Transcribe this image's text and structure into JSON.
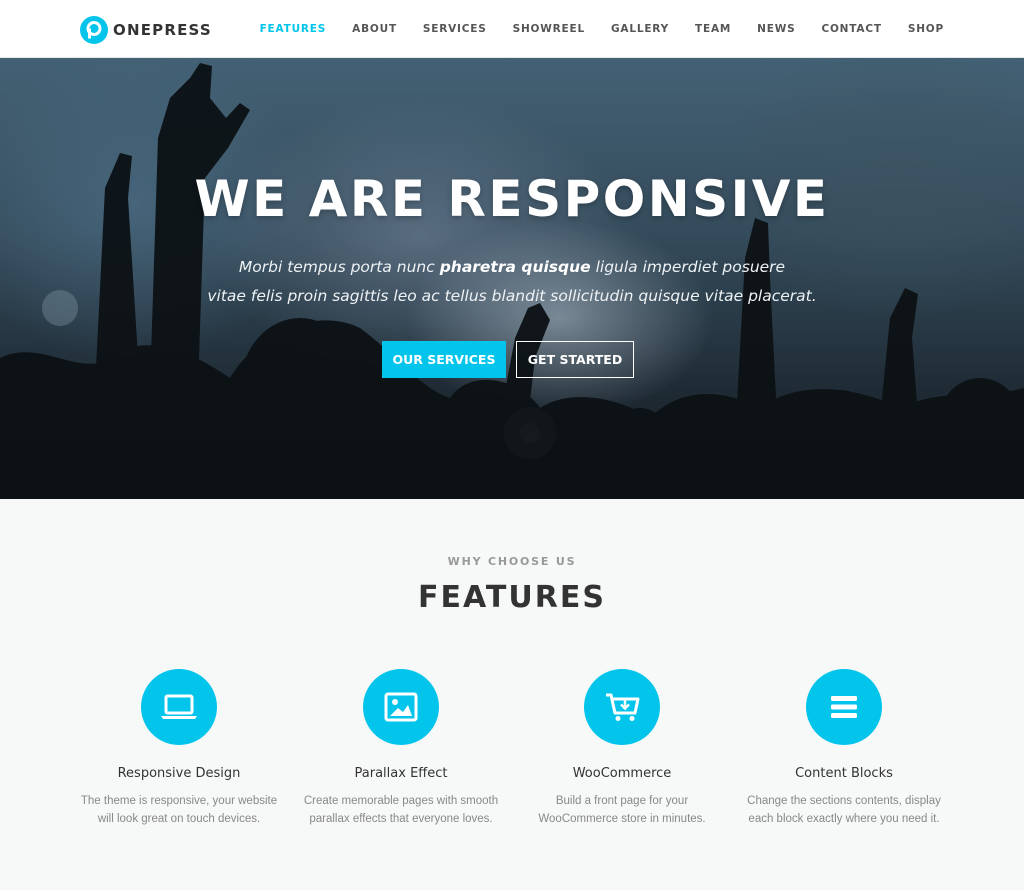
{
  "brand": {
    "name": "ONEPRESS",
    "accent_color": "#03c4eb"
  },
  "nav": {
    "items": [
      {
        "label": "FEATURES",
        "active": true
      },
      {
        "label": "ABOUT",
        "active": false
      },
      {
        "label": "SERVICES",
        "active": false
      },
      {
        "label": "SHOWREEL",
        "active": false
      },
      {
        "label": "GALLERY",
        "active": false
      },
      {
        "label": "TEAM",
        "active": false
      },
      {
        "label": "NEWS",
        "active": false
      },
      {
        "label": "CONTACT",
        "active": false
      },
      {
        "label": "SHOP",
        "active": false
      }
    ]
  },
  "hero": {
    "title": "WE ARE RESPONSIVE",
    "subtitle_part1": "Morbi tempus porta nunc ",
    "subtitle_bold": "pharetra quisque",
    "subtitle_part2": " ligula imperdiet posuere",
    "subtitle_line2": "vitae felis proin sagittis leo ac tellus blandit sollicitudin quisque vitae placerat.",
    "primary_button": "OUR SERVICES",
    "secondary_button": "GET STARTED"
  },
  "features": {
    "subtitle": "WHY CHOOSE US",
    "title": "FEATURES",
    "items": [
      {
        "icon": "laptop-icon",
        "title": "Responsive Design",
        "desc_line1": "The theme is responsive, your website",
        "desc_line2": "will look great on touch devices."
      },
      {
        "icon": "image-icon",
        "title": "Parallax Effect",
        "desc_line1": "Create memorable pages with smooth",
        "desc_line2": "parallax effects that everyone loves."
      },
      {
        "icon": "cart-download-icon",
        "title": "WooCommerce",
        "desc_line1": "Build a front page for your",
        "desc_line2": "WooCommerce store in minutes."
      },
      {
        "icon": "bars-icon",
        "title": "Content Blocks",
        "desc_line1": "Change the sections contents, display",
        "desc_line2": "each block exactly where you need it."
      }
    ]
  }
}
